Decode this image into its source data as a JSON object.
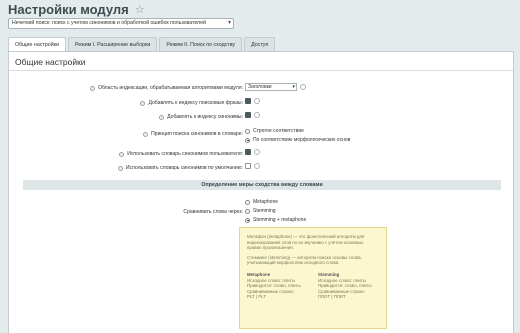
{
  "page": {
    "title": "Настройки модуля",
    "module_select": "Нечеткий поиск: поиск с учетом синонимов и обработкой ошибок пользователей"
  },
  "tabs": [
    {
      "label": "Общие настройки"
    },
    {
      "label": "Режим I. Расширение выборки"
    },
    {
      "label": "Режим II. Поиск по сходству"
    },
    {
      "label": "Доступ"
    }
  ],
  "panel": {
    "heading": "Общие настройки"
  },
  "options": {
    "scope": {
      "label": "Область индексации, обрабатываемая алгоритмами модуля:",
      "value": "Заголовки"
    },
    "add_phrases": {
      "label": "Добавлять к индексу поисковые фразы:"
    },
    "add_synonyms": {
      "label": "Добавлять к индексу синонимы:"
    },
    "principle": {
      "label": "Принцип поиска синонимов в словаре:",
      "options": [
        "Строгое соответствие",
        "По соответствию морфологических основ"
      ]
    },
    "user_dict": {
      "label": "Использовать словарь синонимов пользователя:"
    },
    "default_dict": {
      "label": "Использовать словарь синонимов по умолчанию:"
    }
  },
  "section": {
    "title": "Определение меры сходства между словами"
  },
  "compare": {
    "label": "Сравнивать слова через:",
    "options": [
      "Metaphone",
      "Stemming",
      "Stemming + metaphone"
    ]
  },
  "help": {
    "p1": "Метафон (metaphone) — это фонетический алгоритм для индексирования слов по их звучанию с учётом основных правил произношения.",
    "p2": "Стемминг (stemming) — алгоритм поиска основы слова, учитывающий морфологию исходного слова.",
    "col1": {
      "title": "Metaphone",
      "l1": "Исходное слово: плиты",
      "l2": "Приводится: слово, плиты",
      "l3": "Сравниваемые строки:",
      "l4": "PLT | PLT"
    },
    "col2": {
      "title": "Stemming",
      "l1": "Исходное слово: плиты",
      "l2": "Приводится: слово, плиты",
      "l3": "Сравниваемые строки:",
      "l4": "ПЛОТ | ПЛИТ"
    }
  }
}
